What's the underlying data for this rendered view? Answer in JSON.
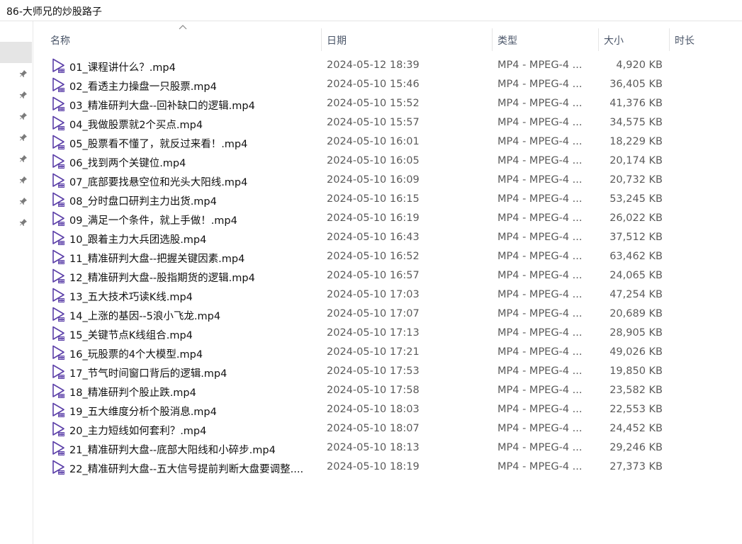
{
  "window": {
    "title": "86-大师兄的炒股路子"
  },
  "columns": {
    "name": "名称",
    "date": "日期",
    "type": "类型",
    "size": "大小",
    "duration": "时长"
  },
  "files": [
    {
      "name": "01_课程讲什么？.mp4",
      "date": "2024-05-12 18:39",
      "type": "MP4 - MPEG-4 ...",
      "size": "4,920 KB"
    },
    {
      "name": "02_看透主力操盘一只股票.mp4",
      "date": "2024-05-10 15:46",
      "type": "MP4 - MPEG-4 ...",
      "size": "36,405 KB"
    },
    {
      "name": "03_精准研判大盘--回补缺口的逻辑.mp4",
      "date": "2024-05-10 15:52",
      "type": "MP4 - MPEG-4 ...",
      "size": "41,376 KB"
    },
    {
      "name": "04_我做股票就2个买点.mp4",
      "date": "2024-05-10 15:57",
      "type": "MP4 - MPEG-4 ...",
      "size": "34,575 KB"
    },
    {
      "name": "05_股票看不懂了，就反过来看！.mp4",
      "date": "2024-05-10 16:01",
      "type": "MP4 - MPEG-4 ...",
      "size": "18,229 KB"
    },
    {
      "name": "06_找到两个关键位.mp4",
      "date": "2024-05-10 16:05",
      "type": "MP4 - MPEG-4 ...",
      "size": "20,174 KB"
    },
    {
      "name": "07_底部要找悬空位和光头大阳线.mp4",
      "date": "2024-05-10 16:09",
      "type": "MP4 - MPEG-4 ...",
      "size": "20,732 KB"
    },
    {
      "name": "08_分时盘口研判主力出货.mp4",
      "date": "2024-05-10 16:15",
      "type": "MP4 - MPEG-4 ...",
      "size": "53,245 KB"
    },
    {
      "name": "09_满足一个条件，就上手做！.mp4",
      "date": "2024-05-10 16:19",
      "type": "MP4 - MPEG-4 ...",
      "size": "26,022 KB"
    },
    {
      "name": "10_跟着主力大兵团选股.mp4",
      "date": "2024-05-10 16:43",
      "type": "MP4 - MPEG-4 ...",
      "size": "37,512 KB"
    },
    {
      "name": "11_精准研判大盘--把握关键因素.mp4",
      "date": "2024-05-10 16:52",
      "type": "MP4 - MPEG-4 ...",
      "size": "63,462 KB"
    },
    {
      "name": "12_精准研判大盘--股指期货的逻辑.mp4",
      "date": "2024-05-10 16:57",
      "type": "MP4 - MPEG-4 ...",
      "size": "24,065 KB"
    },
    {
      "name": "13_五大技术巧读K线.mp4",
      "date": "2024-05-10 17:03",
      "type": "MP4 - MPEG-4 ...",
      "size": "47,254 KB"
    },
    {
      "name": "14_上涨的基因--5浪小飞龙.mp4",
      "date": "2024-05-10 17:07",
      "type": "MP4 - MPEG-4 ...",
      "size": "20,689 KB"
    },
    {
      "name": "15_关键节点K线组合.mp4",
      "date": "2024-05-10 17:13",
      "type": "MP4 - MPEG-4 ...",
      "size": "28,905 KB"
    },
    {
      "name": "16_玩股票的4个大模型.mp4",
      "date": "2024-05-10 17:21",
      "type": "MP4 - MPEG-4 ...",
      "size": "49,026 KB"
    },
    {
      "name": "17_节气时间窗口背后的逻辑.mp4",
      "date": "2024-05-10 17:53",
      "type": "MP4 - MPEG-4 ...",
      "size": "19,850 KB"
    },
    {
      "name": "18_精准研判个股止跌.mp4",
      "date": "2024-05-10 17:58",
      "type": "MP4 - MPEG-4 ...",
      "size": "23,582 KB"
    },
    {
      "name": "19_五大维度分析个股消息.mp4",
      "date": "2024-05-10 18:03",
      "type": "MP4 - MPEG-4 ...",
      "size": "22,553 KB"
    },
    {
      "name": "20_主力短线如何套利？.mp4",
      "date": "2024-05-10 18:07",
      "type": "MP4 - MPEG-4 ...",
      "size": "24,452 KB"
    },
    {
      "name": "21_精准研判大盘--底部大阳线和小碎步.mp4",
      "date": "2024-05-10 18:13",
      "type": "MP4 - MPEG-4 ...",
      "size": "29,246 KB"
    },
    {
      "name": "22_精准研判大盘--五大信号提前判断大盘要调整....",
      "date": "2024-05-10 18:19",
      "type": "MP4 - MPEG-4 ...",
      "size": "27,373 KB"
    }
  ],
  "icons": {
    "file": "video-file-icon",
    "pin": "pin-icon",
    "sort": "sort-ascending-icon"
  },
  "colors": {
    "icon_accent": "#5b3fa8",
    "selection": "#e5e5e5",
    "header_text": "#4a5568"
  }
}
